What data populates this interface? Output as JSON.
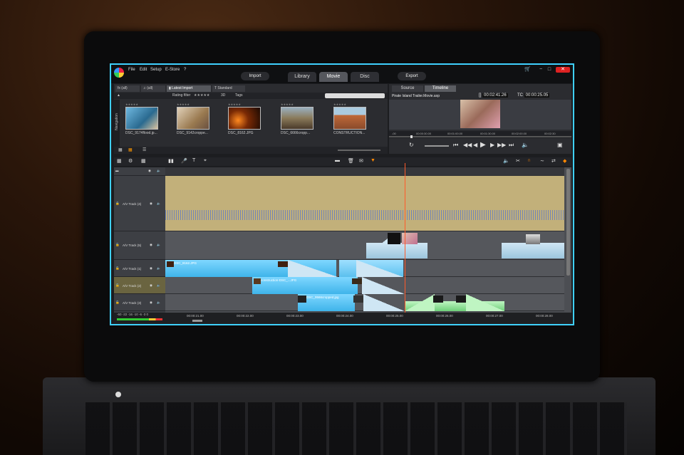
{
  "app": {
    "menu": [
      "File",
      "Edit",
      "Setup",
      "E-Store"
    ],
    "help_glyph": "?",
    "import_label": "Import",
    "modes": [
      "Library",
      "Movie",
      "Disc"
    ],
    "export_label": "Export",
    "window_controls": [
      "−",
      "□",
      "✕"
    ]
  },
  "library": {
    "tabs": [
      "(all)",
      "(all)",
      "Latest Import",
      "Standard"
    ],
    "rating_filter_label": "Rating filter",
    "rating_stars": "★★★★★",
    "view_3d": "3D",
    "tags_label": "Tags",
    "navigation_label": "Navigation",
    "thumbnails": [
      {
        "caption": "DSC_9174flood.jp...",
        "color": "#4a8fb4"
      },
      {
        "caption": "DSC_9142croppe...",
        "color": "#b89a70"
      },
      {
        "caption": "DSC_8162.JPG",
        "color": "#c75a10"
      },
      {
        "caption": "DSC_6666cropp...",
        "color": "#8a7a5a"
      },
      {
        "caption": "CONSTRUCTION...",
        "color": "#b86a40"
      }
    ]
  },
  "preview": {
    "tabs": [
      "Source",
      "Timeline"
    ],
    "title": "Pirate Island Trailer.Movie.axp",
    "duration": "00:02:41.26",
    "tc_label": "TC",
    "timecode": "00:00:25.05",
    "ruler": [
      "-00",
      "00:00:30.00",
      "00:01:00.00",
      "00:01:30.00",
      "00:02:00.00",
      "00:02:30"
    ]
  },
  "timeline": {
    "tracks": [
      {
        "label": "A/V Track (4)"
      },
      {
        "label": "A/V Track (5)"
      },
      {
        "label": "A/V Track (1)"
      },
      {
        "label": "A/V Track (2)"
      },
      {
        "label": "A/V Track (3)"
      }
    ],
    "clips": {
      "t1_a": "DSC_8162.JPG",
      "t2_a": "construction-DSC_...JPG",
      "t3_a": "DSC_9566cropped.jpg"
    },
    "ruler": [
      "00:00:21.00",
      "00:00:22.00",
      "00:00:23.00",
      "00:00:24.00",
      "00:00:25.00",
      "00:00:26.00",
      "00:00:27.00",
      "00:00:28.00"
    ],
    "meter_scale": "-60  -22  -16  -10  -6  -3  0"
  },
  "colors": {
    "accent": "#3fd0ff",
    "playhead": "#ff5a2a",
    "clip_blue": "#3fb4ea",
    "audio_track": "#c2b07a"
  }
}
